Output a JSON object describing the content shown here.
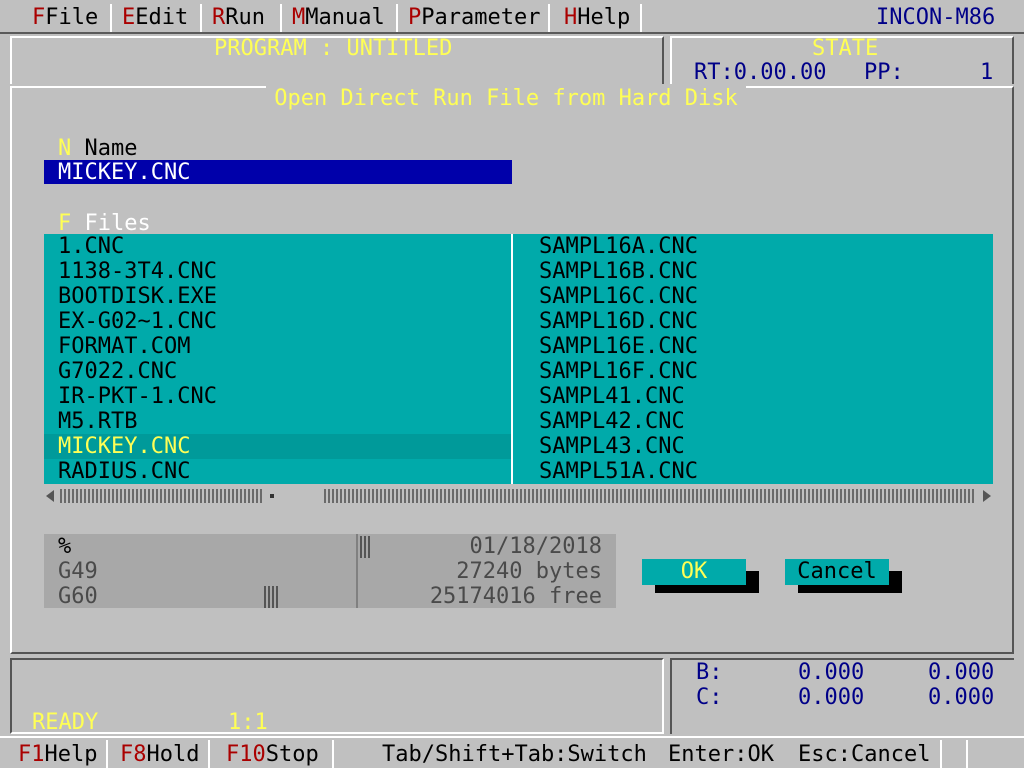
{
  "menu": [
    {
      "key": "F",
      "label": "File"
    },
    {
      "key": "E",
      "label": "Edit"
    },
    {
      "key": "R",
      "label": "Run"
    },
    {
      "key": "M",
      "label": "Manual"
    },
    {
      "key": "P",
      "label": "Parameter"
    },
    {
      "key": "H",
      "label": "Help"
    }
  ],
  "app_title": "INCON-M86",
  "program_label": "PROGRAM : UNTITLED",
  "state": {
    "title": "STATE",
    "rt": "RT:0.00.00",
    "pp_label": "PP:",
    "pp_value": "1"
  },
  "dialog": {
    "title": "Open Direct Run File from Hard Disk",
    "name_hotkey": "N",
    "name_label": "Name",
    "name_value": "MICKEY.CNC",
    "files_hotkey": "F",
    "files_label": "Files",
    "files_left": [
      "1.CNC",
      "1138-3T4.CNC",
      "BOOTDISK.EXE",
      "EX-G02~1.CNC",
      "FORMAT.COM",
      "G7022.CNC",
      "IR-PKT-1.CNC",
      "M5.RTB",
      "MICKEY.CNC",
      "RADIUS.CNC"
    ],
    "files_right": [
      "SAMPL16A.CNC",
      "SAMPL16B.CNC",
      "SAMPL16C.CNC",
      "SAMPL16D.CNC",
      "SAMPL16E.CNC",
      "SAMPL16F.CNC",
      "SAMPL41.CNC",
      "SAMPL42.CNC",
      "SAMPL43.CNC",
      "SAMPL51A.CNC"
    ],
    "selected_file": "MICKEY.CNC",
    "info": {
      "line1_left": "%",
      "line2_left": "G49",
      "line3_left": "G60",
      "date": "01/18/2018",
      "size": "27240 bytes",
      "free": "25174016 free"
    },
    "ok_label": "OK",
    "cancel_label": "Cancel"
  },
  "axes": [
    {
      "label": "B:",
      "v1": "0.000",
      "v2": "0.000"
    },
    {
      "label": "C:",
      "v1": "0.000",
      "v2": "0.000"
    }
  ],
  "status": {
    "ready": "READY",
    "ratio": "1:1"
  },
  "fkeys": [
    {
      "key": "F1",
      "label": "Help"
    },
    {
      "key": "F8",
      "label": "Hold"
    },
    {
      "key": "F10",
      "label": "Stop"
    }
  ],
  "hints": [
    "Tab/Shift+Tab:Switch",
    "Enter:OK",
    "Esc:Cancel"
  ],
  "colors": {
    "background": "#c0c0c0",
    "list_bg": "#00aaaa",
    "input_bg": "#0000aa",
    "highlight_text": "#ffff55",
    "hotkey": "#aa0000"
  }
}
